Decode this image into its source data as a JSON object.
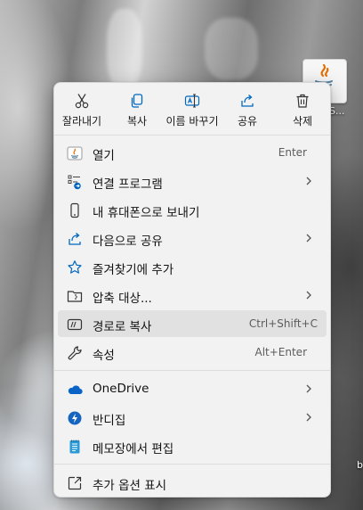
{
  "desktop": {
    "icon_label": "-S...",
    "edge_text": "b"
  },
  "toolbar": {
    "cut": "잘라내기",
    "copy": "복사",
    "rename": "이름 바꾸기",
    "share": "공유",
    "delete": "삭제"
  },
  "menu": {
    "open": {
      "label": "열기",
      "shortcut": "Enter"
    },
    "open_with": {
      "label": "연결 프로그램"
    },
    "send_to_phone": {
      "label": "내 휴대폰으로 보내기"
    },
    "share_with": {
      "label": "다음으로 공유"
    },
    "add_favorites": {
      "label": "즐겨찾기에 추가"
    },
    "compress": {
      "label": "압축 대상..."
    },
    "copy_path": {
      "label": "경로로 복사",
      "shortcut": "Ctrl+Shift+C"
    },
    "properties": {
      "label": "속성",
      "shortcut": "Alt+Enter"
    },
    "onedrive": {
      "label": "OneDrive"
    },
    "bandizip": {
      "label": "반디집"
    },
    "notepad_edit": {
      "label": "메모장에서 편집"
    },
    "more_options": {
      "label": "추가 옵션 표시"
    }
  },
  "colors": {
    "menu_bg": "#f2f2f2",
    "accent_blue": "#0067c0",
    "highlight": "#e1e1e1"
  }
}
